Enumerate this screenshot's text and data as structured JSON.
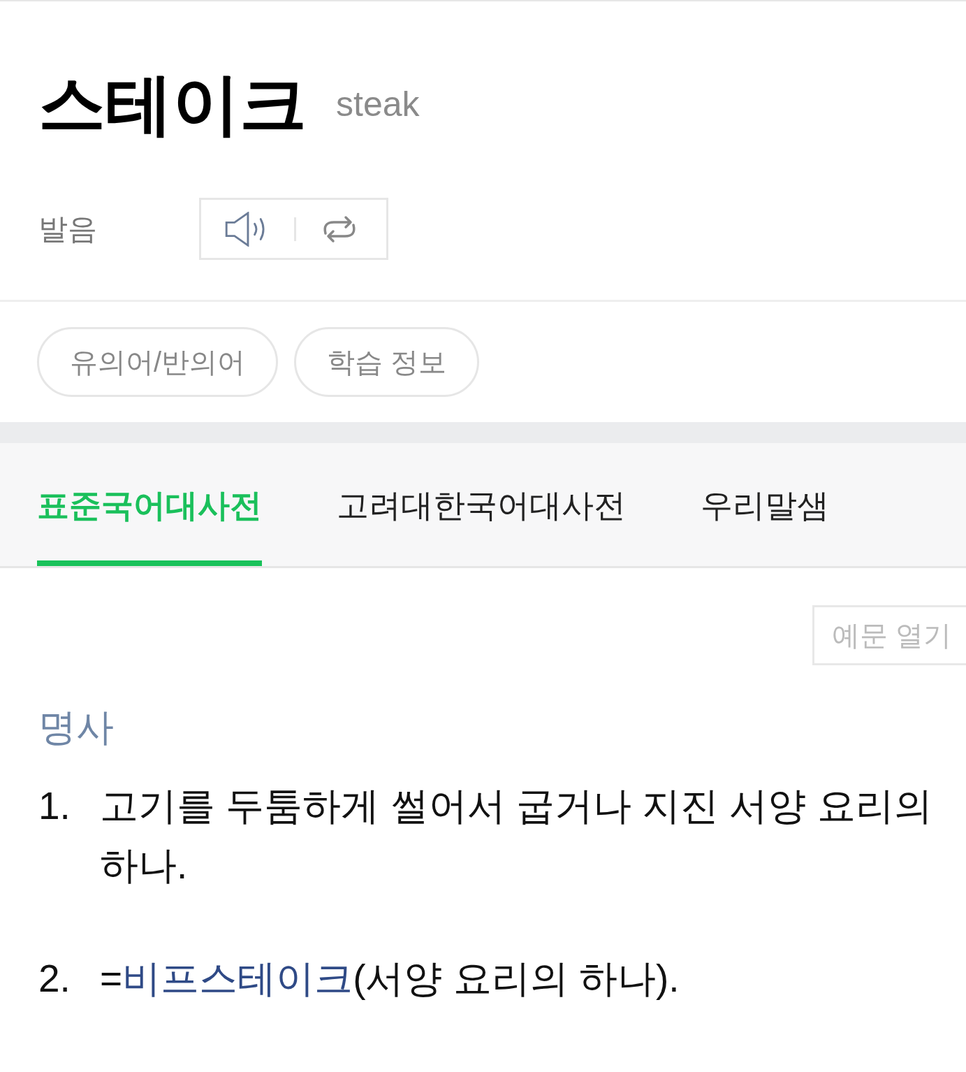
{
  "header": {
    "word": "스테이크",
    "original": "steak"
  },
  "pronunciation": {
    "label": "발음"
  },
  "chips": [
    "유의어/반의어",
    "학습 정보"
  ],
  "tabs": [
    {
      "label": "표준국어대사전",
      "selected": true
    },
    {
      "label": "고려대한국어대사전",
      "selected": false
    },
    {
      "label": "우리말샘",
      "selected": false
    }
  ],
  "examples_button": {
    "label": "예문 열기"
  },
  "entry": {
    "part_of_speech": "명사",
    "definitions": [
      {
        "number": "1.",
        "parts": [
          {
            "kind": "text",
            "text": "고기를 두툼하게 썰어서 굽거나 지진 서양 요리의 하나."
          }
        ]
      },
      {
        "number": "2.",
        "parts": [
          {
            "kind": "text",
            "text": "="
          },
          {
            "kind": "link",
            "text": "비프스테이크"
          },
          {
            "kind": "text",
            "text": "(서양 요리의 하나)."
          }
        ]
      }
    ]
  }
}
